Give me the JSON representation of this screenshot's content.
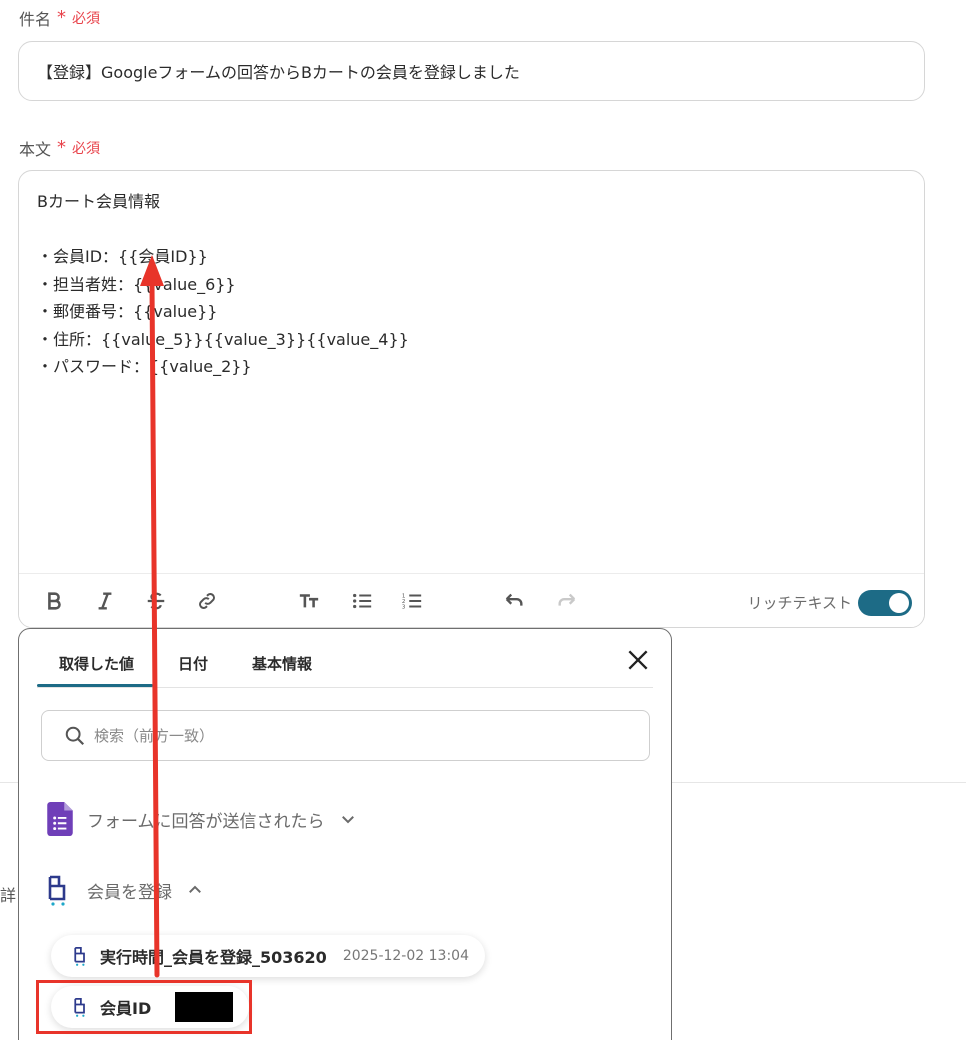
{
  "subject": {
    "label": "件名",
    "required": "必須",
    "value": "【登録】Googleフォームの回答からBカートの会員を登録しました"
  },
  "body": {
    "label": "本文",
    "required": "必須",
    "lines": [
      "Bカート会員情報",
      "",
      "・会員ID：{{会員ID}}",
      "・担当者姓：{{value_6}}",
      "・郵便番号：{{value}}",
      "・住所：{{value_5}}{{value_3}}{{value_4}}",
      "・パスワード：{{value_2}}"
    ]
  },
  "toolbar": {
    "bold_icon": "bold-icon",
    "italic_icon": "italic-icon",
    "strike_icon": "strikethrough-icon",
    "link_icon": "link-icon",
    "heading_icon": "text-size-icon",
    "bullet_icon": "bullet-list-icon",
    "ordered_icon": "ordered-list-icon",
    "undo_icon": "undo-icon",
    "redo_icon": "redo-icon",
    "rich_text_label": "リッチテキスト",
    "rich_text_on": true
  },
  "popup": {
    "tabs": [
      {
        "label": "取得した値",
        "active": true
      },
      {
        "label": "日付",
        "active": false
      },
      {
        "label": "基本情報",
        "active": false
      }
    ],
    "search_placeholder": "検索（前方一致）",
    "sections": [
      {
        "label": "フォームに回答が送信されたら",
        "icon": "google-forms-icon",
        "expanded": false
      },
      {
        "label": "会員を登録",
        "icon": "bcart-icon",
        "expanded": true
      }
    ],
    "items": [
      {
        "label": "実行時間_会員を登録_503620",
        "value": "2025-12-02 13:04"
      },
      {
        "label": "会員ID",
        "value": ""
      }
    ]
  },
  "colors": {
    "accent": "#1d6b86",
    "required": "#e8434b",
    "annotation": "#e8342a"
  }
}
